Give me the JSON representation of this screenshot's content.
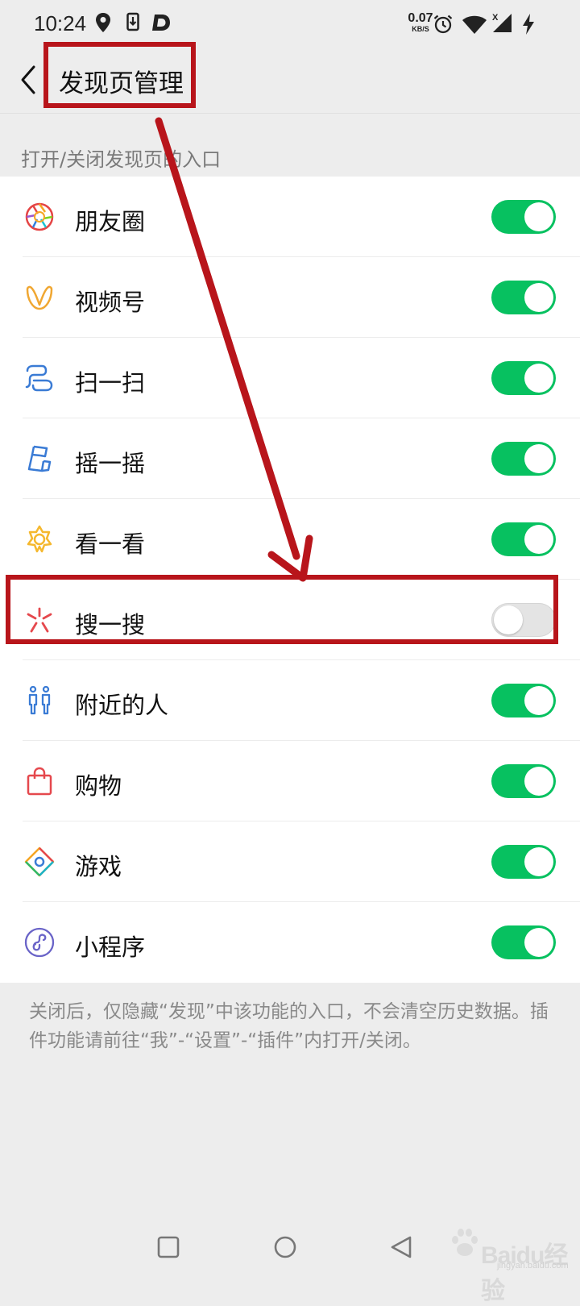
{
  "status_bar": {
    "time": "10:24",
    "net_speed_value": "0.07",
    "net_speed_unit": "KB/S",
    "signal_label": "X"
  },
  "header": {
    "title": "发现页管理"
  },
  "section_label": "打开/关闭发现页的入口",
  "items": [
    {
      "label": "朋友圈",
      "icon": "moments-icon",
      "enabled": true
    },
    {
      "label": "视频号",
      "icon": "channels-icon",
      "enabled": true
    },
    {
      "label": "扫一扫",
      "icon": "scan-icon",
      "enabled": true
    },
    {
      "label": "摇一摇",
      "icon": "shake-icon",
      "enabled": true
    },
    {
      "label": "看一看",
      "icon": "top-stories-icon",
      "enabled": true
    },
    {
      "label": "搜一搜",
      "icon": "search-icon",
      "enabled": false
    },
    {
      "label": "附近的人",
      "icon": "people-nearby-icon",
      "enabled": true
    },
    {
      "label": "购物",
      "icon": "shopping-bag-icon",
      "enabled": true
    },
    {
      "label": "游戏",
      "icon": "games-icon",
      "enabled": true
    },
    {
      "label": "小程序",
      "icon": "mini-programs-icon",
      "enabled": true
    }
  ],
  "footer_note": "关闭后，仅隐藏“发现”中该功能的入口，不会清空历史数据。插件功能请前往“我”-“设置”-“插件”内打开/关闭。",
  "watermark": {
    "logo": "Baidu经验",
    "sub": "jingyan.baidu.com"
  },
  "colors": {
    "toggle_on": "#07c160",
    "annotation": "#b8151b",
    "background": "#ededed"
  }
}
